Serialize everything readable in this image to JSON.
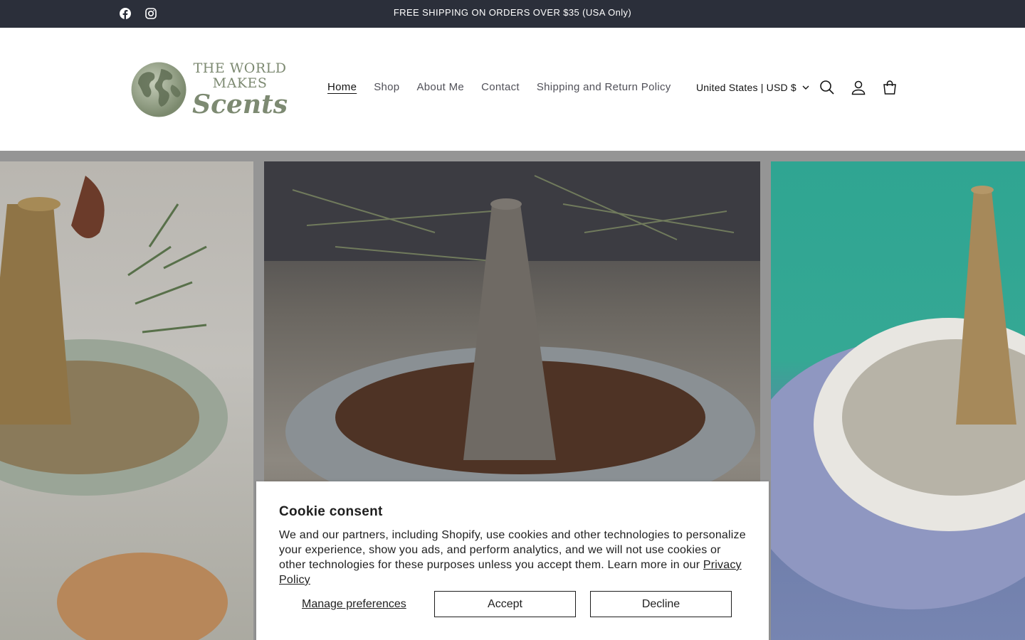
{
  "announcement": {
    "message": "FREE SHIPPING ON ORDERS OVER $35 (USA Only)",
    "socials": [
      {
        "icon": "facebook-icon"
      },
      {
        "icon": "instagram-icon"
      }
    ]
  },
  "header": {
    "logo": {
      "line1": "THE WORLD",
      "line2": "MAKES",
      "line3": "Scents"
    },
    "nav": [
      {
        "label": "Home",
        "active": true
      },
      {
        "label": "Shop",
        "active": false
      },
      {
        "label": "About Me",
        "active": false
      },
      {
        "label": "Contact",
        "active": false
      },
      {
        "label": "Shipping and Return Policy",
        "active": false
      }
    ],
    "locale": "United States | USD $",
    "icons": [
      "search-icon",
      "account-icon",
      "cart-icon"
    ]
  },
  "cookie": {
    "title": "Cookie consent",
    "body": "We and our partners, including Shopify, use cookies and other technologies to personalize your experience, show you ads, and perform analytics, and we will not use cookies or other technologies for these purposes unless you accept them. Learn more in our",
    "link": "Privacy Policy",
    "manage": "Manage preferences",
    "accept": "Accept",
    "decline": "Decline"
  },
  "colors": {
    "announcement_bg": "#2b2f3a",
    "logo_green": "#7d8a72",
    "text": "#121212"
  }
}
